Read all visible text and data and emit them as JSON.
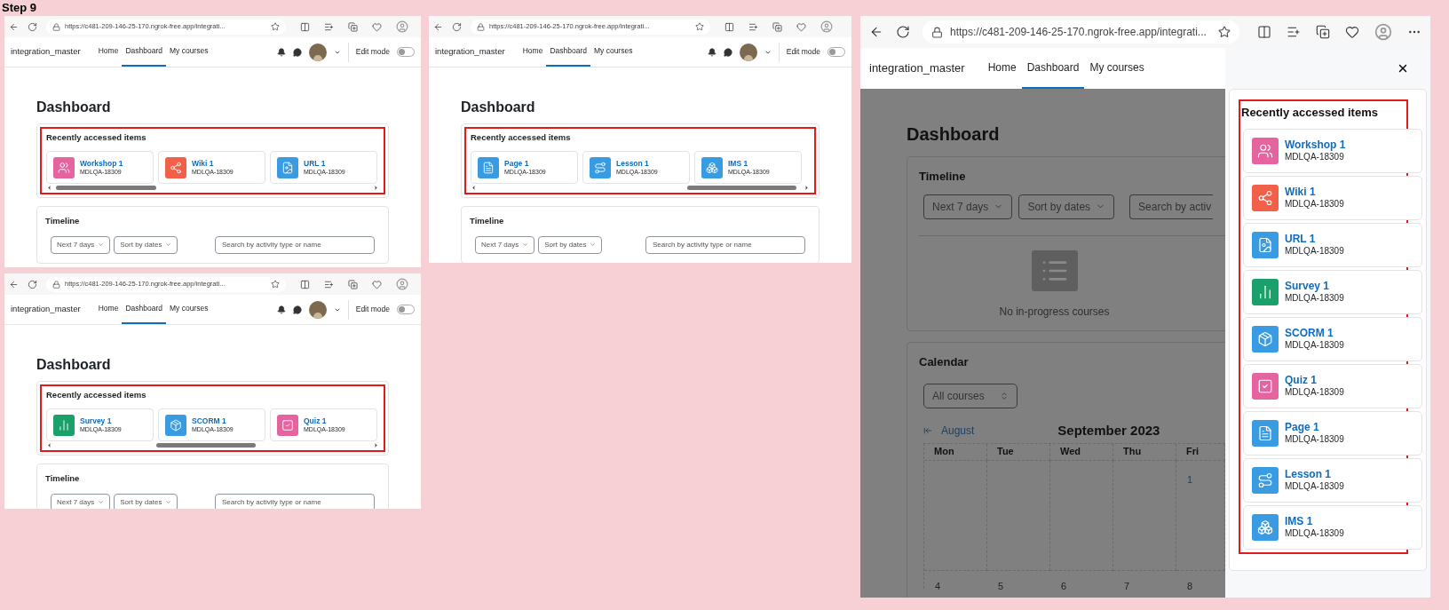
{
  "step_label": "Step 9",
  "screens": [
    {
      "kind": "strip",
      "url": "https://c481-209-146-25-170.ngrok-free.app/integrati...",
      "site_name": "integration_master",
      "nav": [
        {
          "label": "Home",
          "selected": false
        },
        {
          "label": "Dashboard",
          "selected": true
        },
        {
          "label": "My courses",
          "selected": false
        }
      ],
      "edit_mode": {
        "label": "Edit mode",
        "on": false
      },
      "heading": "Dashboard",
      "recent": {
        "title": "Recently accessed items",
        "items": [
          {
            "name": "Workshop 1",
            "course": "MDLQA-18309",
            "kind": "workshop",
            "color": "#e5639f"
          },
          {
            "name": "Wiki 1",
            "course": "MDLQA-18309",
            "kind": "wiki",
            "color": "#f2604a"
          },
          {
            "name": "URL 1",
            "course": "MDLQA-18309",
            "kind": "url",
            "color": "#399be2"
          }
        ]
      },
      "timeline": {
        "title": "Timeline",
        "filters": [
          "Next 7 days",
          "Sort by dates"
        ],
        "search_placeholder": "Search by activity type or name"
      }
    },
    {
      "kind": "strip",
      "url": "https://c481-209-146-25-170.ngrok-free.app/integrati...",
      "site_name": "integration_master",
      "nav": [
        {
          "label": "Home",
          "selected": false
        },
        {
          "label": "Dashboard",
          "selected": true
        },
        {
          "label": "My courses",
          "selected": false
        }
      ],
      "edit_mode": {
        "label": "Edit mode",
        "on": false
      },
      "heading": "Dashboard",
      "recent": {
        "title": "Recently accessed items",
        "items": [
          {
            "name": "Survey 1",
            "course": "MDLQA-18309",
            "kind": "survey",
            "color": "#1aa06a"
          },
          {
            "name": "SCORM 1",
            "course": "MDLQA-18309",
            "kind": "scorm",
            "color": "#399be2"
          },
          {
            "name": "Quiz 1",
            "course": "MDLQA-18309",
            "kind": "quiz",
            "color": "#e5639f"
          }
        ]
      },
      "timeline": {
        "title": "Timeline",
        "filters": [
          "Next 7 days",
          "Sort by dates"
        ],
        "search_placeholder": "Search by activity type or name"
      }
    },
    {
      "kind": "strip",
      "url": "https://c481-209-146-25-170.ngrok-free.app/integrati...",
      "site_name": "integration_master",
      "nav": [
        {
          "label": "Home",
          "selected": false
        },
        {
          "label": "Dashboard",
          "selected": true
        },
        {
          "label": "My courses",
          "selected": false
        }
      ],
      "edit_mode": {
        "label": "Edit mode",
        "on": false
      },
      "heading": "Dashboard",
      "recent": {
        "title": "Recently accessed items",
        "items": [
          {
            "name": "Page 1",
            "course": "MDLQA-18309",
            "kind": "page",
            "color": "#399be2"
          },
          {
            "name": "Lesson 1",
            "course": "MDLQA-18309",
            "kind": "lesson",
            "color": "#399be2"
          },
          {
            "name": "IMS 1",
            "course": "MDLQA-18309",
            "kind": "ims",
            "color": "#399be2"
          }
        ]
      },
      "timeline": {
        "title": "Timeline",
        "filters": [
          "Next 7 days",
          "Sort by dates"
        ],
        "search_placeholder": "Search by activity type or name"
      }
    },
    {
      "kind": "drawer",
      "url": "https://c481-209-146-25-170.ngrok-free.app/integrati...",
      "site_name": "integration_master",
      "nav": [
        {
          "label": "Home",
          "selected": false
        },
        {
          "label": "Dashboard",
          "selected": true
        },
        {
          "label": "My courses",
          "selected": false
        }
      ],
      "heading": "Dashboard",
      "timeline": {
        "title": "Timeline",
        "filters": [
          "Next 7 days",
          "Sort by dates"
        ],
        "search_placeholder": "Search by activ",
        "empty_message": "No in-progress courses"
      },
      "calendar": {
        "title": "Calendar",
        "course_filter": "All courses",
        "prev_month": "August",
        "month": "September 2023",
        "weekdays": [
          "Mon",
          "Tue",
          "Wed",
          "Thu",
          "Fri"
        ],
        "first_week": [
          "1"
        ],
        "second_week": [
          "4",
          "5",
          "6",
          "7",
          "8"
        ]
      },
      "recent": {
        "title": "Recently accessed items",
        "items": [
          {
            "name": "Workshop 1",
            "course": "MDLQA-18309",
            "kind": "workshop",
            "color": "#e5639f"
          },
          {
            "name": "Wiki 1",
            "course": "MDLQA-18309",
            "kind": "wiki",
            "color": "#f2604a"
          },
          {
            "name": "URL 1",
            "course": "MDLQA-18309",
            "kind": "url",
            "color": "#399be2"
          },
          {
            "name": "Survey 1",
            "course": "MDLQA-18309",
            "kind": "survey",
            "color": "#1aa06a"
          },
          {
            "name": "SCORM 1",
            "course": "MDLQA-18309",
            "kind": "scorm",
            "color": "#399be2"
          },
          {
            "name": "Quiz 1",
            "course": "MDLQA-18309",
            "kind": "quiz",
            "color": "#e5639f"
          },
          {
            "name": "Page 1",
            "course": "MDLQA-18309",
            "kind": "page",
            "color": "#399be2"
          },
          {
            "name": "Lesson 1",
            "course": "MDLQA-18309",
            "kind": "lesson",
            "color": "#399be2"
          },
          {
            "name": "IMS 1",
            "course": "MDLQA-18309",
            "kind": "ims",
            "color": "#399be2"
          }
        ]
      }
    }
  ]
}
